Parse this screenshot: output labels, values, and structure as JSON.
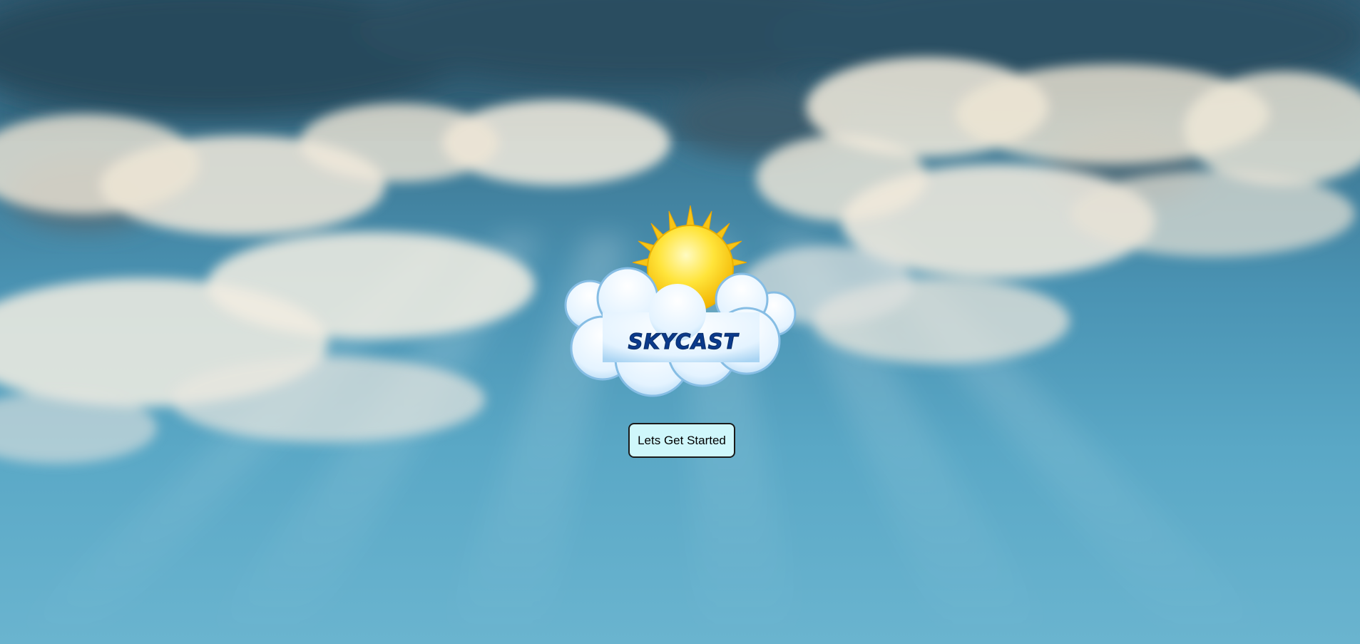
{
  "app": {
    "logo_text": "SKYCAST"
  },
  "main": {
    "start_button_label": "Lets Get Started"
  },
  "colors": {
    "logo_text": "#0b3a8c",
    "sun": "#ffd21f",
    "button_bg": "#cff7fb",
    "cloud": "#eaf6ff"
  },
  "icons": {
    "logo": "sun-behind-cloud-icon"
  }
}
